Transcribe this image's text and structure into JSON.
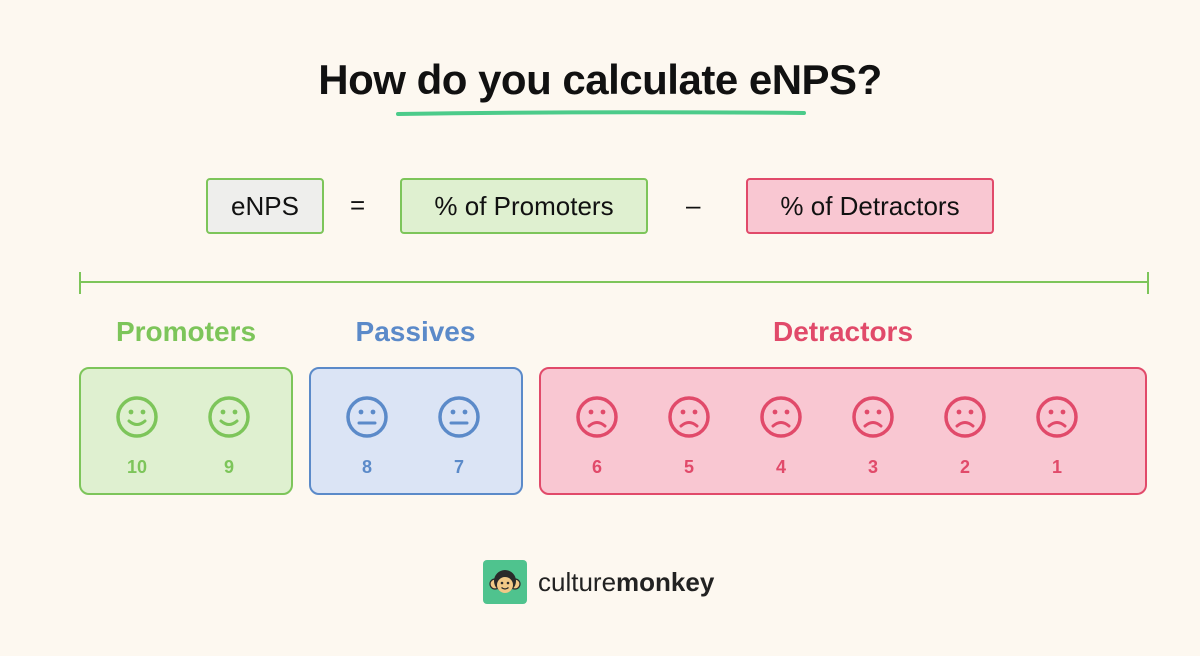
{
  "title": "How do you calculate eNPS?",
  "formula": {
    "result": "eNPS",
    "equals": "=",
    "term1": "% of Promoters",
    "operator": "–",
    "term2": "% of Detractors"
  },
  "colors": {
    "promoters": "#7dc55a",
    "passives": "#5b8ac9",
    "detractors": "#e14a6a",
    "underline": "#4ccb8a",
    "background": "#fdf8f0"
  },
  "groups": [
    {
      "label": "Promoters",
      "icon": "smile-face-icon",
      "scores": [
        "10",
        "9"
      ]
    },
    {
      "label": "Passives",
      "icon": "neutral-face-icon",
      "scores": [
        "8",
        "7"
      ]
    },
    {
      "label": "Detractors",
      "icon": "sad-face-icon",
      "scores": [
        "6",
        "5",
        "4",
        "3",
        "2",
        "1"
      ]
    }
  ],
  "brand": {
    "logo_icon": "monkey-face-icon",
    "name_light": "culture",
    "name_bold": "monkey"
  }
}
